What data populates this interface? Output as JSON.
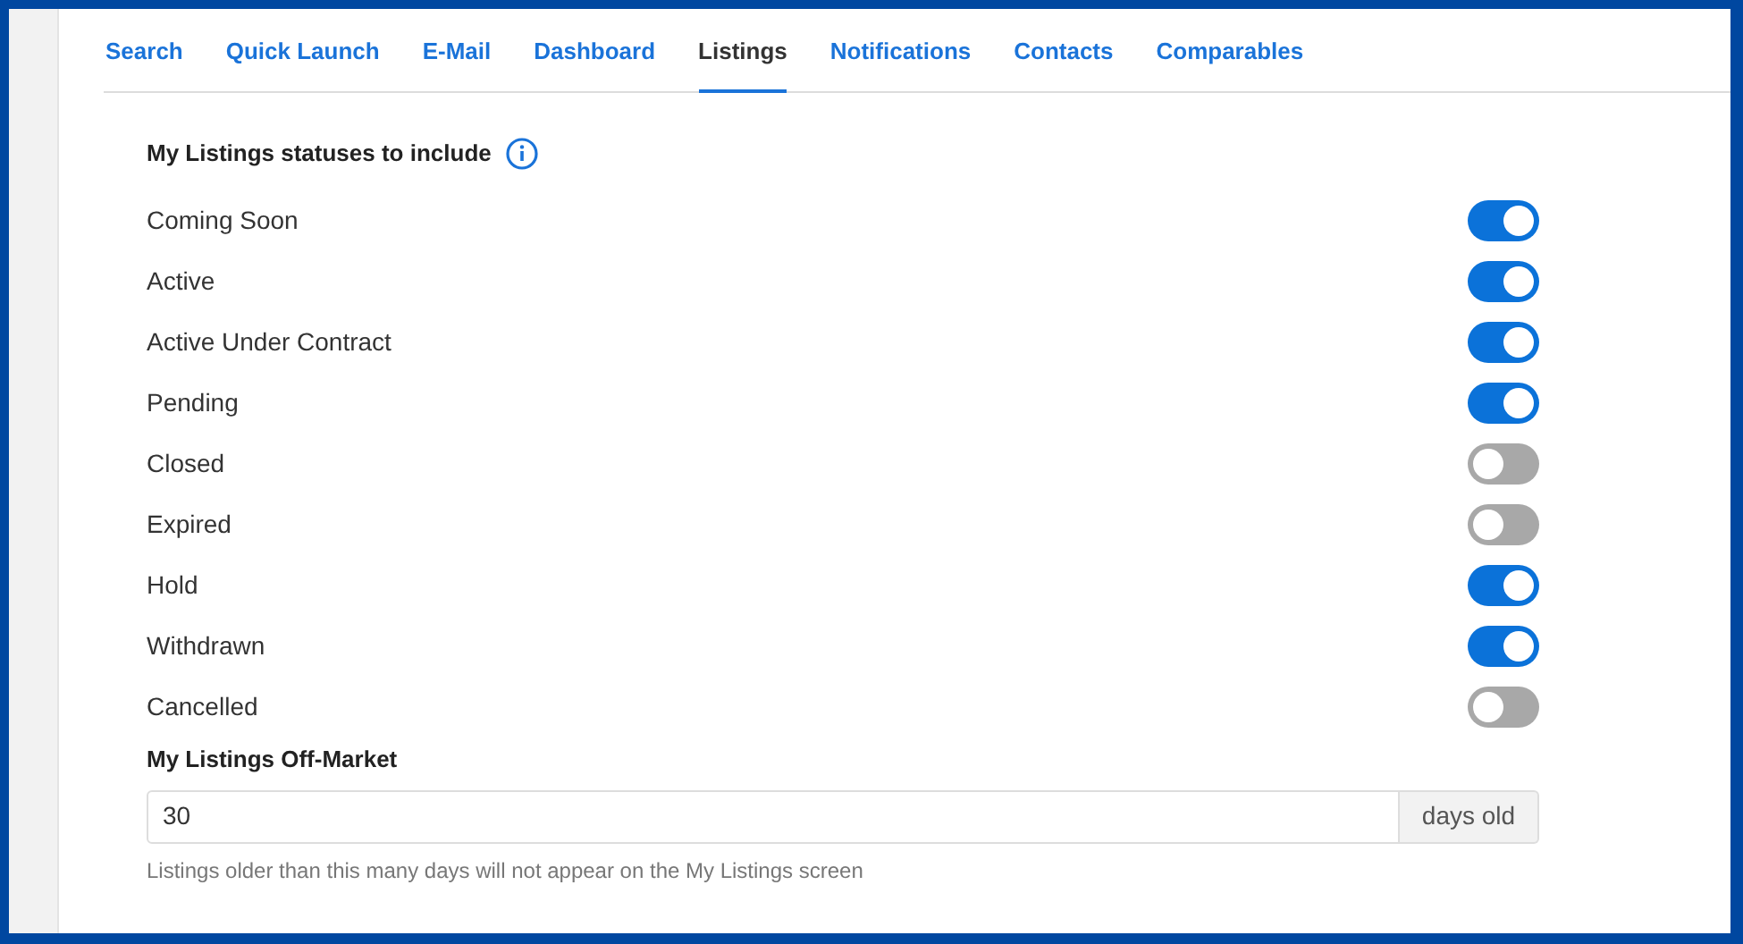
{
  "tabs": [
    {
      "label": "Search",
      "selected": false
    },
    {
      "label": "Quick Launch",
      "selected": false
    },
    {
      "label": "E-Mail",
      "selected": false
    },
    {
      "label": "Dashboard",
      "selected": false
    },
    {
      "label": "Listings",
      "selected": true
    },
    {
      "label": "Notifications",
      "selected": false
    },
    {
      "label": "Contacts",
      "selected": false
    },
    {
      "label": "Comparables",
      "selected": false
    }
  ],
  "statuses": {
    "title": "My Listings statuses to include",
    "items": [
      {
        "label": "Coming Soon",
        "on": true
      },
      {
        "label": "Active",
        "on": true
      },
      {
        "label": "Active Under Contract",
        "on": true
      },
      {
        "label": "Pending",
        "on": true
      },
      {
        "label": "Closed",
        "on": false
      },
      {
        "label": "Expired",
        "on": false
      },
      {
        "label": "Hold",
        "on": true
      },
      {
        "label": "Withdrawn",
        "on": true
      },
      {
        "label": "Cancelled",
        "on": false
      }
    ]
  },
  "off_market": {
    "title": "My Listings Off-Market",
    "value": "30",
    "addon": "days old",
    "help": "Listings older than this many days will not appear on the My Listings screen"
  }
}
